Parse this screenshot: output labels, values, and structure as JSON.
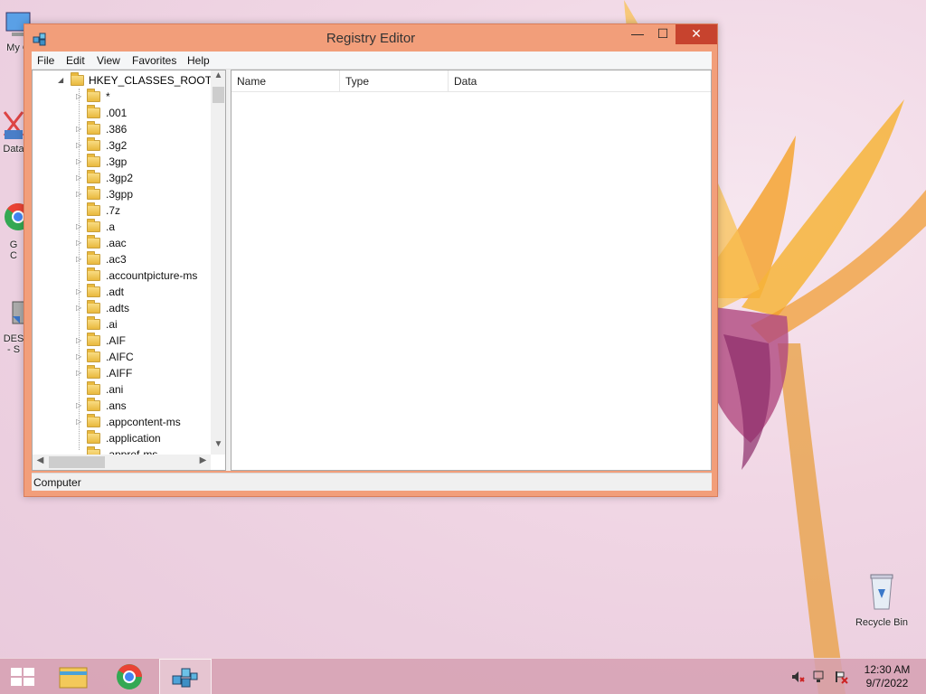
{
  "window": {
    "title": "Registry Editor",
    "menu": [
      "File",
      "Edit",
      "View",
      "Favorites",
      "Help"
    ],
    "controls": {
      "minimize": "—",
      "maximize": "☐",
      "close": "✕"
    }
  },
  "tree": {
    "root": "HKEY_CLASSES_ROOT",
    "items": [
      {
        "label": "*",
        "expandable": true
      },
      {
        "label": ".001",
        "expandable": false
      },
      {
        "label": ".386",
        "expandable": true
      },
      {
        "label": ".3g2",
        "expandable": true
      },
      {
        "label": ".3gp",
        "expandable": true
      },
      {
        "label": ".3gp2",
        "expandable": true
      },
      {
        "label": ".3gpp",
        "expandable": true
      },
      {
        "label": ".7z",
        "expandable": false
      },
      {
        "label": ".a",
        "expandable": true
      },
      {
        "label": ".aac",
        "expandable": true
      },
      {
        "label": ".ac3",
        "expandable": true
      },
      {
        "label": ".accountpicture-ms",
        "expandable": false
      },
      {
        "label": ".adt",
        "expandable": true
      },
      {
        "label": ".adts",
        "expandable": true
      },
      {
        "label": ".ai",
        "expandable": false
      },
      {
        "label": ".AIF",
        "expandable": true
      },
      {
        "label": ".AIFC",
        "expandable": true
      },
      {
        "label": ".AIFF",
        "expandable": true
      },
      {
        "label": ".ani",
        "expandable": false
      },
      {
        "label": ".ans",
        "expandable": true
      },
      {
        "label": ".appcontent-ms",
        "expandable": true
      },
      {
        "label": ".application",
        "expandable": false
      },
      {
        "label": ".appref-ms",
        "expandable": false
      }
    ]
  },
  "list": {
    "columns": [
      "Name",
      "Type",
      "Data"
    ]
  },
  "status": "Computer",
  "desktop": {
    "icons": [
      {
        "label": "My C",
        "icon": "computer-icon"
      },
      {
        "label": "Data",
        "icon": "database-icon"
      },
      {
        "label": "G\nC",
        "icon": "chrome-icon"
      },
      {
        "label": "DES\n- S",
        "icon": "shortcut-icon"
      },
      {
        "label": "Recycle Bin",
        "icon": "recycle-bin-icon"
      }
    ]
  },
  "taskbar": {
    "time": "12:30 AM",
    "date": "9/7/2022",
    "apps": [
      "start-icon",
      "file-explorer-icon",
      "chrome-icon",
      "regedit-icon"
    ]
  },
  "colors": {
    "window_frame": "#f29e7a",
    "close_button": "#c7432e",
    "folder": "#e9b93e"
  }
}
